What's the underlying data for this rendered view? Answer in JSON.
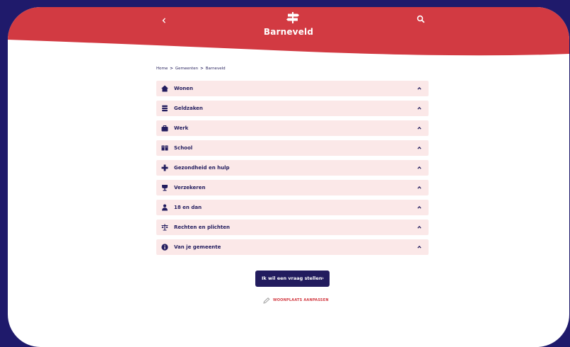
{
  "header": {
    "title": "Barneveld",
    "back_icon": "chevron-left-icon",
    "search_icon": "search-icon",
    "logo_icon": "signpost-icon",
    "brand_color": "#d23a42"
  },
  "breadcrumb": {
    "items": [
      "Home",
      "Gemeenten",
      "Barneveld"
    ],
    "separator": ">"
  },
  "categories": [
    {
      "label": "Wonen",
      "icon": "house-icon"
    },
    {
      "label": "Geldzaken",
      "icon": "coins-icon"
    },
    {
      "label": "Werk",
      "icon": "briefcase-icon"
    },
    {
      "label": "School",
      "icon": "book-icon"
    },
    {
      "label": "Gezondheid en hulp",
      "icon": "cross-icon"
    },
    {
      "label": "Verzekeren",
      "icon": "umbrella-icon"
    },
    {
      "label": "18 en dan",
      "icon": "person-icon"
    },
    {
      "label": "Rechten en plichten",
      "icon": "scales-icon"
    },
    {
      "label": "Van je gemeente",
      "icon": "info-icon"
    }
  ],
  "cta": {
    "label": "Ik wil een vraag stellen",
    "arrow": "›"
  },
  "change_residence": {
    "label": "WOONPLAATS AANPASSEN",
    "icon": "pencil-icon"
  },
  "colors": {
    "background": "#1f1a6b",
    "accent": "#d23a42",
    "navy": "#221c5e",
    "row": "#fbe8e8"
  }
}
